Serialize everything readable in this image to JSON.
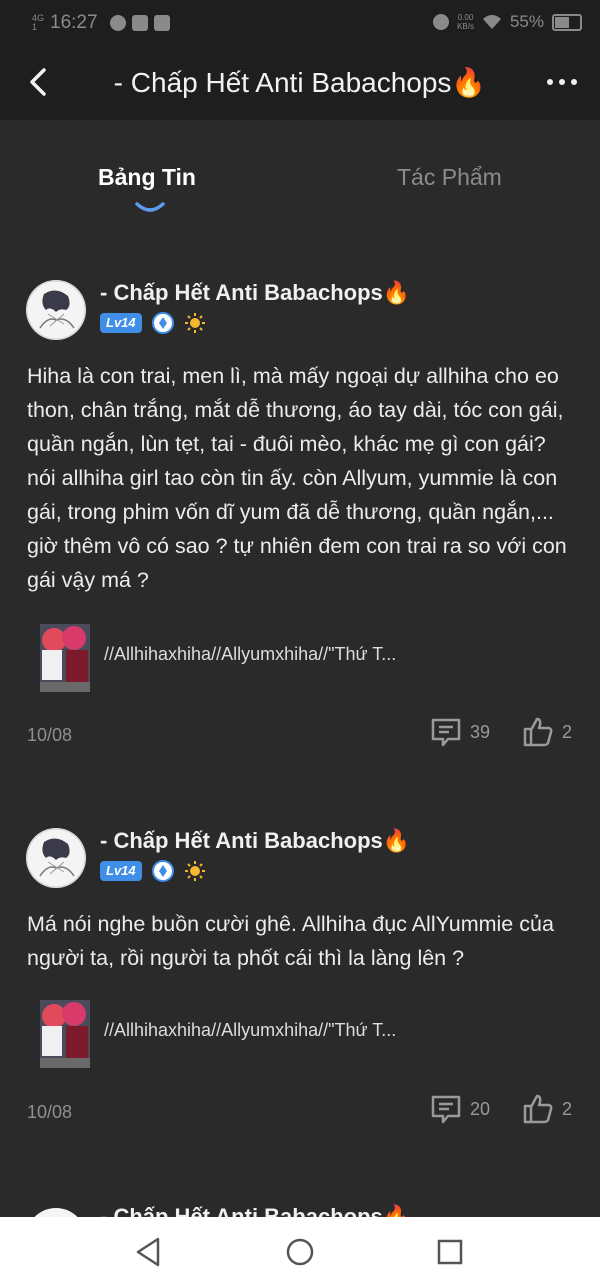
{
  "status_bar": {
    "network": "4G",
    "signal": "1",
    "time": "16:27",
    "speed_value": "0.00",
    "speed_unit": "KB/s",
    "battery": "55%",
    "battery_level": 0.55
  },
  "header": {
    "title": "- Chấp Hết Anti Babachops🔥"
  },
  "tabs": [
    {
      "label": "Bảng Tin",
      "active": true
    },
    {
      "label": "Tác Phẩm",
      "active": false
    }
  ],
  "posts": [
    {
      "author": "- Chấp Hết Anti Babachops🔥",
      "level": "Lv14",
      "text": "Hiha là con trai, men lì, mà mấy ngoại dự allhiha cho eo thon, chân trắng, mắt dễ thương, áo tay dài, tóc con gái, quần ngắn, lùn tẹt, tai - đuôi mèo, khác mẹ gì con gái? nói allhiha girl tao còn tin ấy. còn Allyum, yummie là con gái, trong phim vốn dĩ yum đã dễ thương, quần ngắn,... giờ thêm vô có sao ? tự nhiên đem con trai ra so với con gái vậy má ?",
      "attachment": "//Allhihaxhiha//Allyumxhiha//\"Thứ T...",
      "date": "10/08",
      "comments": "39",
      "likes": "2"
    },
    {
      "author": "- Chấp Hết Anti Babachops🔥",
      "level": "Lv14",
      "text": "Má nói nghe buồn cười ghê. Allhiha đục AllYummie của người ta, rồi người ta phốt cái thì la làng lên ?",
      "attachment": "//Allhihaxhiha//Allyumxhiha//\"Thứ T...",
      "date": "10/08",
      "comments": "20",
      "likes": "2"
    },
    {
      "author": "- Chấp Hết Anti Babachops🔥"
    }
  ],
  "colors": {
    "background": "#2a2a2a",
    "header": "#1e1e1e",
    "accent": "#3f8ee8",
    "tab_indicator": "#5b9bf0"
  }
}
